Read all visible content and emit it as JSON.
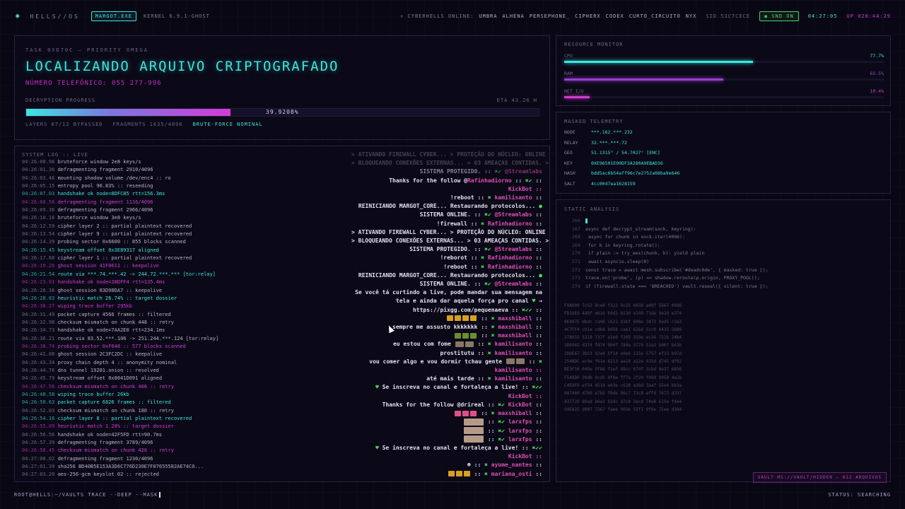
{
  "topbar": {
    "brand": "HELLS//OS",
    "process": "MARGOT.EXE",
    "kernel": "KERNEL 6.9.1-GHOST",
    "online_label": "CYBERHELLS ONLINE:",
    "users": [
      "UMBRA",
      "ALHENA",
      "PERSEPHONE_",
      "CIPHERX",
      "CODEX",
      "CURTO_CIRCUITO",
      "NYX"
    ],
    "sid": "SID 53C7CECE",
    "snd": "SND ON",
    "clock": "04:27:05",
    "uptime": "UP 020:44:29"
  },
  "task": {
    "id": "TASK 0XD70C — PRIORITY OMEGA",
    "title": "LOCALIZANDO ARQUIVO CRIPTOGRAFADO",
    "phone": "NÚMERO TELEFÔNICO: 055 277-996",
    "progress_label": "DECRYPTION PROGRESS",
    "eta": "ETA 43.26 H",
    "progress_text": "39.9208%",
    "progress_value": 0.399208,
    "layers": "LAYERS 07/12 BYPASSED",
    "fragments": "FRAGMENTS 1635/4096",
    "bruteforce": "BRUTE-FORCE NOMINAL"
  },
  "log": {
    "header": "SYSTEM LOG :: LIVE",
    "lines": [
      {
        "t": "04:26:00.96",
        "m": "bruteforce window 2e8 keys/s",
        "c": "normal"
      },
      {
        "t": "04:26:01.36",
        "m": "defragmenting fragment 2910/4096",
        "c": "normal"
      },
      {
        "t": "04:26:03.46",
        "m": "mounting shadow volume /dev/enc4 :: ro",
        "c": "normal"
      },
      {
        "t": "04:26:05.15",
        "m": "entropy pool 96.83% :: reseeding",
        "c": "normal"
      },
      {
        "t": "04:26:07.03",
        "m": "handshake ok node=8DFC85 rtt=156.3ms",
        "c": "cyan"
      },
      {
        "t": "04:26:08.58",
        "m": "defragmenting fragment 1116/4096",
        "c": "mag"
      },
      {
        "t": "04:26:09.36",
        "m": "defragmenting fragment 2966/4096",
        "c": "normal"
      },
      {
        "t": "04:26:10.16",
        "m": "bruteforce window 3e8 keys/s",
        "c": "normal"
      },
      {
        "t": "04:26:12.59",
        "m": "cipher layer 2 :: partial plaintext recovered",
        "c": "normal"
      },
      {
        "t": "04:26:13.54",
        "m": "cipher layer 9 :: partial plaintext recovered",
        "c": "normal"
      },
      {
        "t": "04:26:14.39",
        "m": "probing sector 0x6600 :: 855 blocks scanned",
        "c": "normal"
      },
      {
        "t": "04:26:15.45",
        "m": "keystream offset 0x3E89317 aligned",
        "c": "cyan"
      },
      {
        "t": "04:26:17.68",
        "m": "cipher layer 1 :: partial plaintext recovered",
        "c": "normal"
      },
      {
        "t": "04:26:19.26",
        "m": "ghost session 41F0611 :: keepalive",
        "c": "mag"
      },
      {
        "t": "04:26:21.54",
        "m": "route via ***.74.***.42 -> 244.72.***.*** [tor:relay]",
        "c": "cyan"
      },
      {
        "t": "04:26:23.91",
        "m": "handshake ok node=38DFF4 rtt=135.4ms",
        "c": "mag"
      },
      {
        "t": "04:26:26.36",
        "m": "ghost session 83D98DA7 :: keepalive",
        "c": "normal"
      },
      {
        "t": "04:26:28.83",
        "m": "heuristic match 26.74% :: target dossier",
        "c": "cyan"
      },
      {
        "t": "04:26:30.27",
        "m": "wiping trace buffer 295kb",
        "c": "mag"
      },
      {
        "t": "04:26:31.49",
        "m": "packet capture 4566 frames :: filtered",
        "c": "normal"
      },
      {
        "t": "04:26:32.98",
        "m": "checksum mismatch on chunk 448 :: retry",
        "c": "normal"
      },
      {
        "t": "04:26:34.73",
        "m": "handshake ok node=7AA2E0 rtt=234.1ms",
        "c": "normal"
      },
      {
        "t": "04:26:36.21",
        "m": "route via 83.52.***.106 -> 251.244.***.124 [tor:relay]",
        "c": "normal"
      },
      {
        "t": "04:26:38.74",
        "m": "probing sector 0xF648 :: 577 blocks scanned",
        "c": "mag"
      },
      {
        "t": "04:26:41.08",
        "m": "ghost session 2C3FC2DC :: keepalive",
        "c": "normal"
      },
      {
        "t": "04:26:43.34",
        "m": "proxy chain depth 4 :: anonymity nominal",
        "c": "normal"
      },
      {
        "t": "04:26:44.76",
        "m": "dns tunnel 19281.onion :: resolved",
        "c": "normal"
      },
      {
        "t": "04:26:45.79",
        "m": "keystream offset 0x8041D091 aligned",
        "c": "normal"
      },
      {
        "t": "04:26:47.56",
        "m": "checksum mismatch on chunk 406 :: retry",
        "c": "mag"
      },
      {
        "t": "04:26:48.58",
        "m": "wiping trace buffer 26kb",
        "c": "cyan"
      },
      {
        "t": "04:26:50.63",
        "m": "packet capture 6826 frames :: filtered",
        "c": "cyan"
      },
      {
        "t": "04:26:52.03",
        "m": "checksum mismatch on chunk 180 :: retry",
        "c": "normal"
      },
      {
        "t": "04:26:54.16",
        "m": "cipher layer 8 :: partial plaintext recovered",
        "c": "cyan"
      },
      {
        "t": "04:26:55.09",
        "m": "heuristic match 1.28% :: target dossier",
        "c": "mag"
      },
      {
        "t": "04:26:56.56",
        "m": "handshake ok node=42F5FD rtt=90.7ms",
        "c": "normal"
      },
      {
        "t": "04:26:57.39",
        "m": "defragmenting fragment 3789/4096",
        "c": "normal"
      },
      {
        "t": "04:26:58.45",
        "m": "checksum mismatch on chunk 420 :: retry",
        "c": "mag"
      },
      {
        "t": "04:27:00.02",
        "m": "defragmenting fragment 1230/4096",
        "c": "normal"
      },
      {
        "t": "04:27:01.39",
        "m": "sha256 BD40B5E153A3D6C776D230E7F07655582AE74C0...",
        "c": "normal"
      },
      {
        "t": "04:27:03.20",
        "m": "aes-256-gcm keyslot 02 :: rejected",
        "c": "normal"
      }
    ]
  },
  "chat": [
    {
      "text": "> ATIVANDO FIREWALL CYBER... > PROTEÇÃO DO NÚCLEO: ONLINE",
      "cls": "faded"
    },
    {
      "text": "> BLOQUEANDO CONEXÕES EXTERNAS... > 03 AMEAÇAS CONTIDAS. >",
      "cls": "faded"
    },
    {
      "text": "SISTEMA PROTEGIDO. :: ✖✔ @Streamlabs",
      "cls": "faded2"
    },
    {
      "text": "Thanks for the follow @Rafinhadiorno :: ✖✔ ::",
      "cls": ""
    },
    {
      "text": "KickBot ::",
      "cls": "bot"
    },
    {
      "text": "!reboot :: ✖ kamilisanto ::",
      "cls": ""
    },
    {
      "text": "REINICIANDO MARGOT_CORE... Restaurando protocolos... ●",
      "cls": ""
    },
    {
      "text": "SISTEMA ONLINE. :: ✖✔ @Streamlabs ::",
      "cls": ""
    },
    {
      "text": "!firewall :: ✖ Rafinhadiorno ::",
      "cls": ""
    },
    {
      "text": "> ATIVANDO FIREWALL CYBER... > PROTEÇÃO DO NÚCLEO: ONLINE",
      "cls": ""
    },
    {
      "text": "> BLOQUEANDO CONEXÕES EXTERNAS... > 03 AMEAÇAS CONTIDAS. >",
      "cls": ""
    },
    {
      "text": "SISTEMA PROTEGIDO. :: ✖✔ @Streamlabs ::",
      "cls": ""
    },
    {
      "text": "!reborot :: ✖ Rafinhadiorno ::",
      "cls": ""
    },
    {
      "text": "!reboot :: ✖ Rafinhadiorno ::",
      "cls": ""
    },
    {
      "text": "REINICIANDO MARGOT_CORE... Restaurando protocolos... ●",
      "cls": ""
    },
    {
      "text": "SISTEMA ONLINE. :: ✖✔ @Streamlabs ::",
      "cls": ""
    },
    {
      "text": "Se você tá curtindo a live, pode mandar sua mensagem na",
      "cls": ""
    },
    {
      "text": "tela e ainda dar aquela força pro canal ♥ →",
      "cls": ""
    },
    {
      "text": "https://pixgg.com/pequenaeva :: ✖✔✔ ::",
      "cls": ""
    },
    {
      "text": "▮▮▮▮ :: ✖ maxshiball ::",
      "cls": "emo-y"
    },
    {
      "text": "sempre me assusto kkkkkkk :: ✖ maxshiball ::",
      "cls": ""
    },
    {
      "text": "▮▮▮ :: ✖ maxshiball ::",
      "cls": "emo-g"
    },
    {
      "text": "eu estou com fome ▮▮ :: ✖ kamilisanto ::",
      "cls": ""
    },
    {
      "text": "prostitutu :: ✖ kamilisanto ::",
      "cls": ""
    },
    {
      "text": "vou comer algo e vou dormir tchau gente ▮▮ :: ✖",
      "cls": ""
    },
    {
      "text": "kamilisanto ::",
      "cls": "bot"
    },
    {
      "text": "até mais tarde :: ✖ kamilisanto ::",
      "cls": ""
    },
    {
      "text": "♥ Se inscreva no canal e fortaleça a live! :: ✖✔✔",
      "cls": ""
    },
    {
      "text": "KickBot ::",
      "cls": "bot"
    },
    {
      "text": "Thanks for the follow @drireal :: ✖✔ KickBot ::",
      "cls": ""
    },
    {
      "text": "▮▮▮ :: ✖ maxshiball ::",
      "cls": "emo-p"
    },
    {
      "text": "▮ :: ✖✔ larxfps ::",
      "cls": "emo-c"
    },
    {
      "text": "▮ :: ✖✔ larxfps ::",
      "cls": "emo-c"
    },
    {
      "text": "▮ :: ✖✔ larxfps ::",
      "cls": "emo-c"
    },
    {
      "text": "♥ Se inscreva no canal e fortaleça a live! :: ✖✔✔",
      "cls": ""
    },
    {
      "text": "KickBot ::",
      "cls": "bot"
    },
    {
      "text": "☻ :: ✖ ayume_nantes ::",
      "cls": ""
    },
    {
      "text": "▮▮▮ :: ✖ mariana_osti ::",
      "cls": "emo-y"
    }
  ],
  "prompt": "ROOT@HELLS:~/VAULTS TRACE --DEEP --MASK",
  "status": "STATUS: SEARCHING",
  "resource": {
    "header": "RESOURCE MONITOR",
    "rows": [
      {
        "label": "CPU",
        "value": "77.7%",
        "fill": 0.777,
        "color": "#3de6df"
      },
      {
        "label": "RAM",
        "value": "65.5%",
        "fill": 0.655,
        "color": "#9a3fd6"
      },
      {
        "label": "NET I/O",
        "value": "10.4%",
        "fill": 0.104,
        "color": "#d43bd6"
      }
    ]
  },
  "telemetry": {
    "header": "MASKED TELEMETRY",
    "rows": [
      {
        "k": "NODE",
        "v": "***.162.***.232"
      },
      {
        "k": "RELAY",
        "v": "32.***.***.72"
      },
      {
        "k": "GEO",
        "v": "51.1315° / 54.7027° [ENC]"
      },
      {
        "k": "KEY",
        "v": "0XE96501E00DF3A280A9EBAD36"
      },
      {
        "k": "HASH",
        "v": "bdd5ac6b54aff96c7e2752a08ba9e646"
      },
      {
        "k": "SALT",
        "v": "4cc0047ea1628159"
      }
    ]
  },
  "static": {
    "header": "STATIC ANALYSIS",
    "code": [
      {
        "n": "266",
        "c": ""
      },
      {
        "n": "267",
        "c": "async def decrypt_stream(sock, keyring):"
      },
      {
        "n": "268",
        "c": "  async for chunk in sock.iter(4096):"
      },
      {
        "n": "269",
        "c": "    for k in keyring.rotate():"
      },
      {
        "n": "270",
        "c": "      if plain := try_aes(chunk, k): yield plain"
      },
      {
        "n": "271",
        "c": "      await asyncio.sleep(0)"
      },
      {
        "n": "272",
        "c": "const trace = await mesh.subscribe('#deadc0de', { masked: true });"
      },
      {
        "n": "273",
        "c": "trace.on('probe', (p) => shadow.reroute(p.origin, PROXY_POOL));"
      },
      {
        "n": "274",
        "c": "if (firewall.state === 'BREACHED') vault.reseal({ silent: true });"
      }
    ],
    "hex": [
      "F9AD09 7c52 9ce0 f322 0c55 6038 a09f 5667 09d8",
      "FD18E9 4d9f e616 b9d2 653d a149 71de 9e29 e374",
      "8E887E dbdc ca08 cb21 d1bf 608e 3473 0ad5 c3a3",
      "4C7FF4 cb1e cdbd b658 cae1 626d 5cc0 0435 5680",
      "278655 5218 737f a3e0 f205 359e ec34 722b 24b4",
      "3D6942 d374 fd74 904f 784a 5779 51a3 b007 b63b",
      "2DDE67 3b53 02a4 5f14 e0e6 115e 5757 ef33 b97d",
      "254BDC ec9e f61e 8213 aa10 a12e 015d d745 df02",
      "BE3F10 049e 9fbd f1ef d9cc 674f 3cbd 0e37 6836",
      "F548D0 30db 0cd5 0f0e ff7a 2f20 f09d 9958 4a2b",
      "C4E8F0 ef54 d519 e03e c628 a38d 3aaf 55e4 bb3a",
      "0A7A60 d780 e7b5 f0de 06c7 73c8 effd 7673 d337",
      "A37729 80ad b6a3 83dc d7c8 2ec8 74e8 615e f4e4",
      "99E825 d087 7267 faee 903e 55f1 0f6e 75ee d364"
    ]
  },
  "vault": "VAULT MS://VAULT/HIDDEN — 812 ARQUIVOS"
}
